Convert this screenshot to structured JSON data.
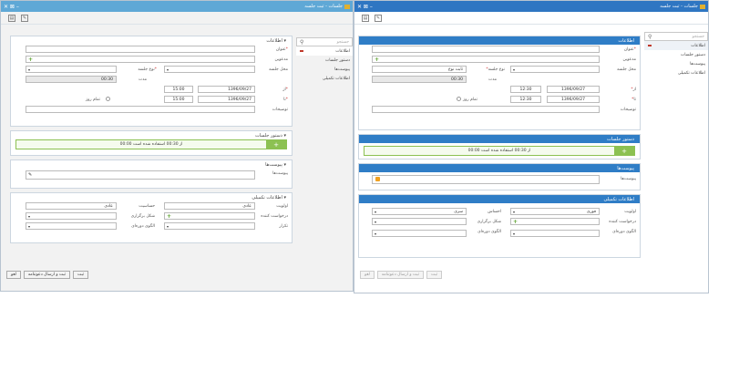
{
  "window_left": {
    "title": "جلسات - ثبت جلسه",
    "controls": "✕ ⊠ –",
    "nav": {
      "search_placeholder": "جستجو",
      "items": [
        "اطلاعات",
        "دستور جلسات",
        "پیوست‌ها",
        "اطلاعات تکمیلی"
      ]
    },
    "sections": {
      "info": "اطلاعات",
      "agenda": "دستور جلسات",
      "attachments": "پیوست‌ها",
      "extra": "اطلاعات تکمیلی"
    },
    "labels": {
      "title": "عنوان",
      "invitees": "مدعوین",
      "location": "محل جلسه",
      "type": "نوع جلسه",
      "duration": "مدت",
      "from": "از",
      "to": "تا",
      "remind": "تمام روز",
      "desc": "توضیحات",
      "attachments": "پیوست‌ها",
      "priority": "اولویت",
      "status": "حساسیت",
      "requester": "درخواست کننده",
      "hold": "شکل برگزاری",
      "period": "تکرار",
      "repeat_pattern": "الگوی دوره‌ای"
    },
    "values": {
      "duration": "00:30",
      "from_time": "15:00",
      "to_time": "15:00",
      "from_date": "1396/09/27",
      "to_date": "1396/09/27",
      "agenda_bar": "00:00 از 00:30 استفاده شده است",
      "priority": "عادی",
      "status": "عادی"
    },
    "buttons": [
      "ثبت",
      "ثبت و ارسال دعوتنامه",
      "لغو"
    ]
  },
  "window_right": {
    "title": "جلسات - ثبت جلسه",
    "controls": "✕ ⊠ –",
    "nav": {
      "search_placeholder": "جستجو",
      "items": [
        "اطلاعات",
        "دستور جلسات",
        "پیوست‌ها",
        "اطلاعات تکمیلی"
      ]
    },
    "sections": {
      "info": "اطلاعات",
      "agenda": "دستور جلسات",
      "attachments": "پیوست‌ها",
      "extra": "اطلاعات تکمیلی"
    },
    "labels": {
      "title": "عنوان",
      "invitees": "مدعوین",
      "location": "محل جلسه",
      "type": "نوع جلسه",
      "duration": "مدت",
      "from": "از",
      "to": "تا",
      "remind": "تمام روز",
      "desc": "توضیحات",
      "attachments": "پیوست‌ها",
      "priority": "اولویت",
      "status": "احساس",
      "requester": "درخواست کننده",
      "hold": "شکل برگزاری",
      "repeat_pattern": "الگوی دوره‌ای",
      "repeat_pattern2": "الگوی دوره‌ای"
    },
    "values": {
      "type_value": "ثابت نوع",
      "duration": "00:30",
      "from_time": "12:30",
      "to_time": "12:30",
      "from_date": "1396/09/27",
      "to_date": "1396/09/27",
      "agenda_bar": "00:00 از 00:30 استفاده شده است",
      "priority": "فوری",
      "status": "سری"
    },
    "buttons": [
      "ثبت",
      "ثبت و ارسال دعوتنامه",
      "لغو"
    ]
  }
}
